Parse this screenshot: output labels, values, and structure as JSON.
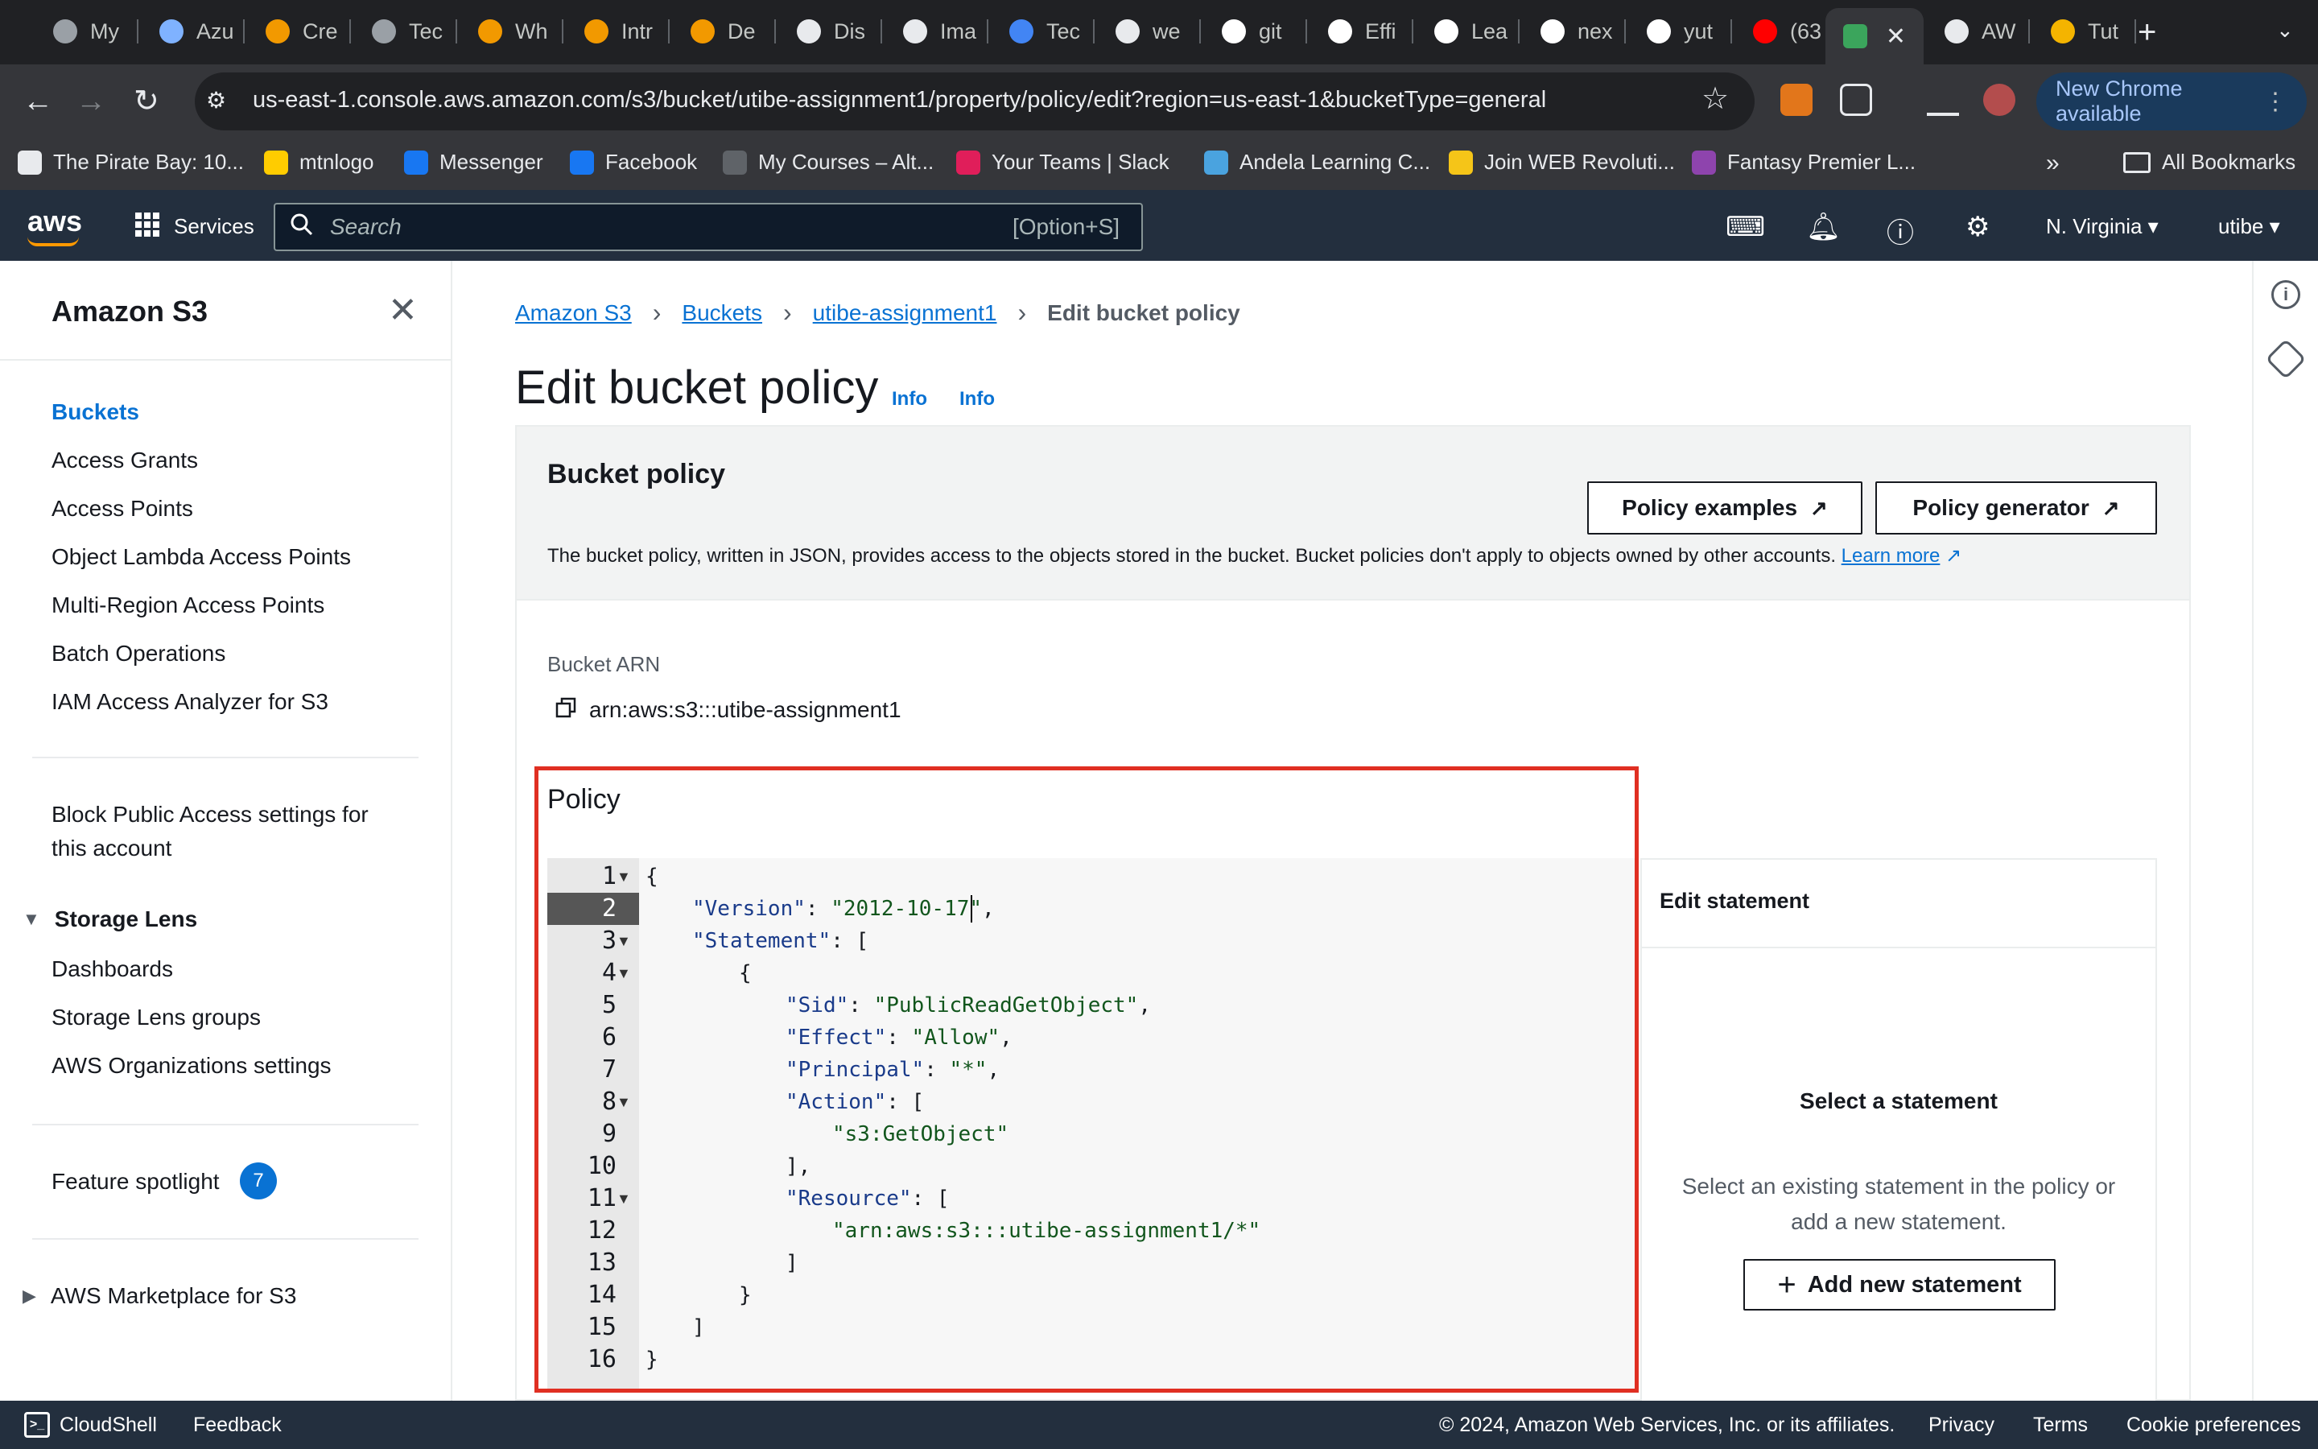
{
  "browser": {
    "tabs": [
      {
        "label": "My",
        "color": "#9aa0a6"
      },
      {
        "label": "Azu",
        "color": "#7fb2ff"
      },
      {
        "label": "Cre",
        "color": "#f29900"
      },
      {
        "label": "Tec",
        "color": "#9aa0a6"
      },
      {
        "label": "Wh",
        "color": "#f29900"
      },
      {
        "label": "Intr",
        "color": "#f29900"
      },
      {
        "label": "De",
        "color": "#f29900"
      },
      {
        "label": "Dis",
        "color": "#e8eaed"
      },
      {
        "label": "Ima",
        "color": "#e8eaed"
      },
      {
        "label": "Tec",
        "color": "#4285f4"
      },
      {
        "label": "we",
        "color": "#e8eaed"
      },
      {
        "label": "git",
        "color": "#ffffff"
      },
      {
        "label": "Effi",
        "color": "#ffffff"
      },
      {
        "label": "Lea",
        "color": "#ffffff"
      },
      {
        "label": "nex",
        "color": "#ffffff"
      },
      {
        "label": "yut",
        "color": "#ffffff"
      },
      {
        "label": "(63",
        "color": "#ff0000"
      },
      {
        "label": "AW",
        "color": "#e8eaed"
      },
      {
        "label": "Tut",
        "color": "#f4b400"
      }
    ],
    "active_tab_color": "#3ba55c",
    "url": "us-east-1.console.aws.amazon.com/s3/bucket/utibe-assignment1/property/policy/edit?region=us-east-1&bucketType=general",
    "new_chrome_label": "New Chrome available",
    "bookmarks": [
      {
        "label": "The Pirate Bay: 10...",
        "color": "#e8eaed"
      },
      {
        "label": "mtnlogo",
        "color": "#ffcc00"
      },
      {
        "label": "Messenger",
        "color": "#1877f2"
      },
      {
        "label": "Facebook",
        "color": "#1877f2"
      },
      {
        "label": "My Courses – Alt...",
        "color": "#5f6368"
      },
      {
        "label": "Your Teams | Slack",
        "color": "#e01e5a"
      },
      {
        "label": "Andela Learning C...",
        "color": "#4aa3df"
      },
      {
        "label": "Join WEB Revoluti...",
        "color": "#f5c518"
      },
      {
        "label": "Fantasy Premier L...",
        "color": "#8e44ad"
      }
    ],
    "bookmarks_more": "»",
    "all_bookmarks_label": "All Bookmarks"
  },
  "aws_header": {
    "logo": "aws",
    "services_label": "Services",
    "search_placeholder": "Search",
    "search_shortcut": "[Option+S]",
    "region": "N. Virginia ▾",
    "user": "utibe ▾"
  },
  "sidenav": {
    "title": "Amazon S3",
    "items": [
      {
        "label": "Buckets",
        "active": true
      },
      {
        "label": "Access Grants"
      },
      {
        "label": "Access Points"
      },
      {
        "label": "Object Lambda Access Points"
      },
      {
        "label": "Multi-Region Access Points"
      },
      {
        "label": "Batch Operations"
      },
      {
        "label": "IAM Access Analyzer for S3"
      }
    ],
    "block_public_access_line1": "Block Public Access settings for",
    "block_public_access_line2": "this account",
    "storage_lens": {
      "label": "Storage Lens",
      "items": [
        "Dashboards",
        "Storage Lens groups",
        "AWS Organizations settings"
      ]
    },
    "feature_spotlight": "Feature spotlight",
    "feature_spotlight_count": "7",
    "marketplace": "AWS Marketplace for S3"
  },
  "breadcrumb": {
    "items": [
      "Amazon S3",
      "Buckets",
      "utibe-assignment1"
    ],
    "current": "Edit bucket policy"
  },
  "page": {
    "title": "Edit bucket policy",
    "info_links": [
      "Info",
      "Info"
    ]
  },
  "bucket_policy": {
    "title": "Bucket policy",
    "policy_examples_label": "Policy examples",
    "policy_generator_label": "Policy generator",
    "description": "The bucket policy, written in JSON, provides access to the objects stored in the bucket. Bucket policies don't apply to objects owned by other accounts.",
    "learn_more": "Learn more",
    "arn_label": "Bucket ARN",
    "arn_value": "arn:aws:s3:::utibe-assignment1",
    "policy_label": "Policy",
    "active_line": 2,
    "code_lines": [
      {
        "n": "1",
        "fold": true,
        "indent": 0,
        "key": "",
        "sep": "",
        "val": "",
        "tail": "{"
      },
      {
        "n": "2",
        "fold": false,
        "indent": 1,
        "key": "\"Version\"",
        "sep": ": ",
        "val": "\"2012-10-17\"",
        "tail": ","
      },
      {
        "n": "3",
        "fold": true,
        "indent": 1,
        "key": "\"Statement\"",
        "sep": ": ",
        "val": "",
        "tail": "["
      },
      {
        "n": "4",
        "fold": true,
        "indent": 2,
        "key": "",
        "sep": "",
        "val": "",
        "tail": "{"
      },
      {
        "n": "5",
        "fold": false,
        "indent": 3,
        "key": "\"Sid\"",
        "sep": ": ",
        "val": "\"PublicReadGetObject\"",
        "tail": ","
      },
      {
        "n": "6",
        "fold": false,
        "indent": 3,
        "key": "\"Effect\"",
        "sep": ": ",
        "val": "\"Allow\"",
        "tail": ","
      },
      {
        "n": "7",
        "fold": false,
        "indent": 3,
        "key": "\"Principal\"",
        "sep": ": ",
        "val": "\"*\"",
        "tail": ","
      },
      {
        "n": "8",
        "fold": true,
        "indent": 3,
        "key": "\"Action\"",
        "sep": ": ",
        "val": "",
        "tail": "["
      },
      {
        "n": "9",
        "fold": false,
        "indent": 4,
        "key": "",
        "sep": "",
        "val": "\"s3:GetObject\"",
        "tail": ""
      },
      {
        "n": "10",
        "fold": false,
        "indent": 3,
        "key": "",
        "sep": "",
        "val": "",
        "tail": "],"
      },
      {
        "n": "11",
        "fold": true,
        "indent": 3,
        "key": "\"Resource\"",
        "sep": ": ",
        "val": "",
        "tail": "["
      },
      {
        "n": "12",
        "fold": false,
        "indent": 4,
        "key": "",
        "sep": "",
        "val": "\"arn:aws:s3:::utibe-assignment1/*\"",
        "tail": ""
      },
      {
        "n": "13",
        "fold": false,
        "indent": 3,
        "key": "",
        "sep": "",
        "val": "",
        "tail": "]"
      },
      {
        "n": "14",
        "fold": false,
        "indent": 2,
        "key": "",
        "sep": "",
        "val": "",
        "tail": "}"
      },
      {
        "n": "15",
        "fold": false,
        "indent": 1,
        "key": "",
        "sep": "",
        "val": "",
        "tail": "]"
      },
      {
        "n": "16",
        "fold": false,
        "indent": 0,
        "key": "",
        "sep": "",
        "val": "",
        "tail": "}"
      }
    ],
    "edit_statement": {
      "title": "Edit statement",
      "empty_title": "Select a statement",
      "empty_desc": "Select an existing statement in the policy or add a new statement.",
      "add_button": "Add new statement"
    }
  },
  "footer": {
    "cloudshell": "CloudShell",
    "feedback": "Feedback",
    "copyright": "© 2024, Amazon Web Services, Inc. or its affiliates.",
    "privacy": "Privacy",
    "terms": "Terms",
    "cookie": "Cookie preferences"
  },
  "colors": {
    "aws_header": "#232f3e",
    "link": "#0972d3",
    "highlight_frame": "#e02f22",
    "json_key": "#1a3b8a",
    "json_string": "#12561d"
  }
}
